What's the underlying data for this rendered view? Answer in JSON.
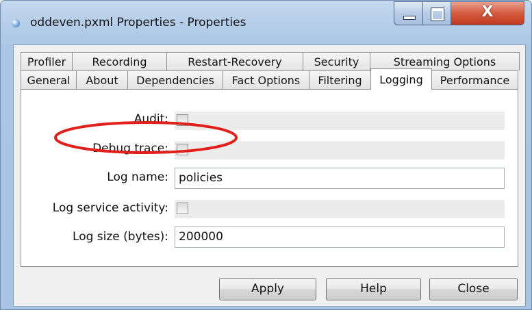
{
  "window": {
    "title": "oddeven.pxml Properties - Properties",
    "controls": {
      "minimize_icon": "minimize-icon",
      "maximize_icon": "maximize-icon",
      "close_icon": "close-icon",
      "close_glyph": "X"
    }
  },
  "tabs": {
    "row1": [
      "Profiler",
      "Recording",
      "Restart-Recovery",
      "Security",
      "Streaming Options"
    ],
    "row2": [
      "General",
      "About",
      "Dependencies",
      "Fact Options",
      "Filtering",
      "Logging",
      "Performance"
    ],
    "active": "Logging"
  },
  "logging": {
    "audit": {
      "label": "Audit:",
      "checked": false
    },
    "debug_trace": {
      "label": "Debug trace:",
      "checked": false
    },
    "log_name": {
      "label": "Log name:",
      "value": "policies"
    },
    "log_service_activity": {
      "label": "Log service activity:",
      "checked": false
    },
    "log_size": {
      "label": "Log size (bytes):",
      "value": "200000"
    }
  },
  "buttons": {
    "apply": "Apply",
    "help": "Help",
    "close": "Close"
  },
  "colors": {
    "highlight_ellipse": "#e0201a",
    "titlebar": "#b8cfea",
    "panel": "#ffffff"
  }
}
